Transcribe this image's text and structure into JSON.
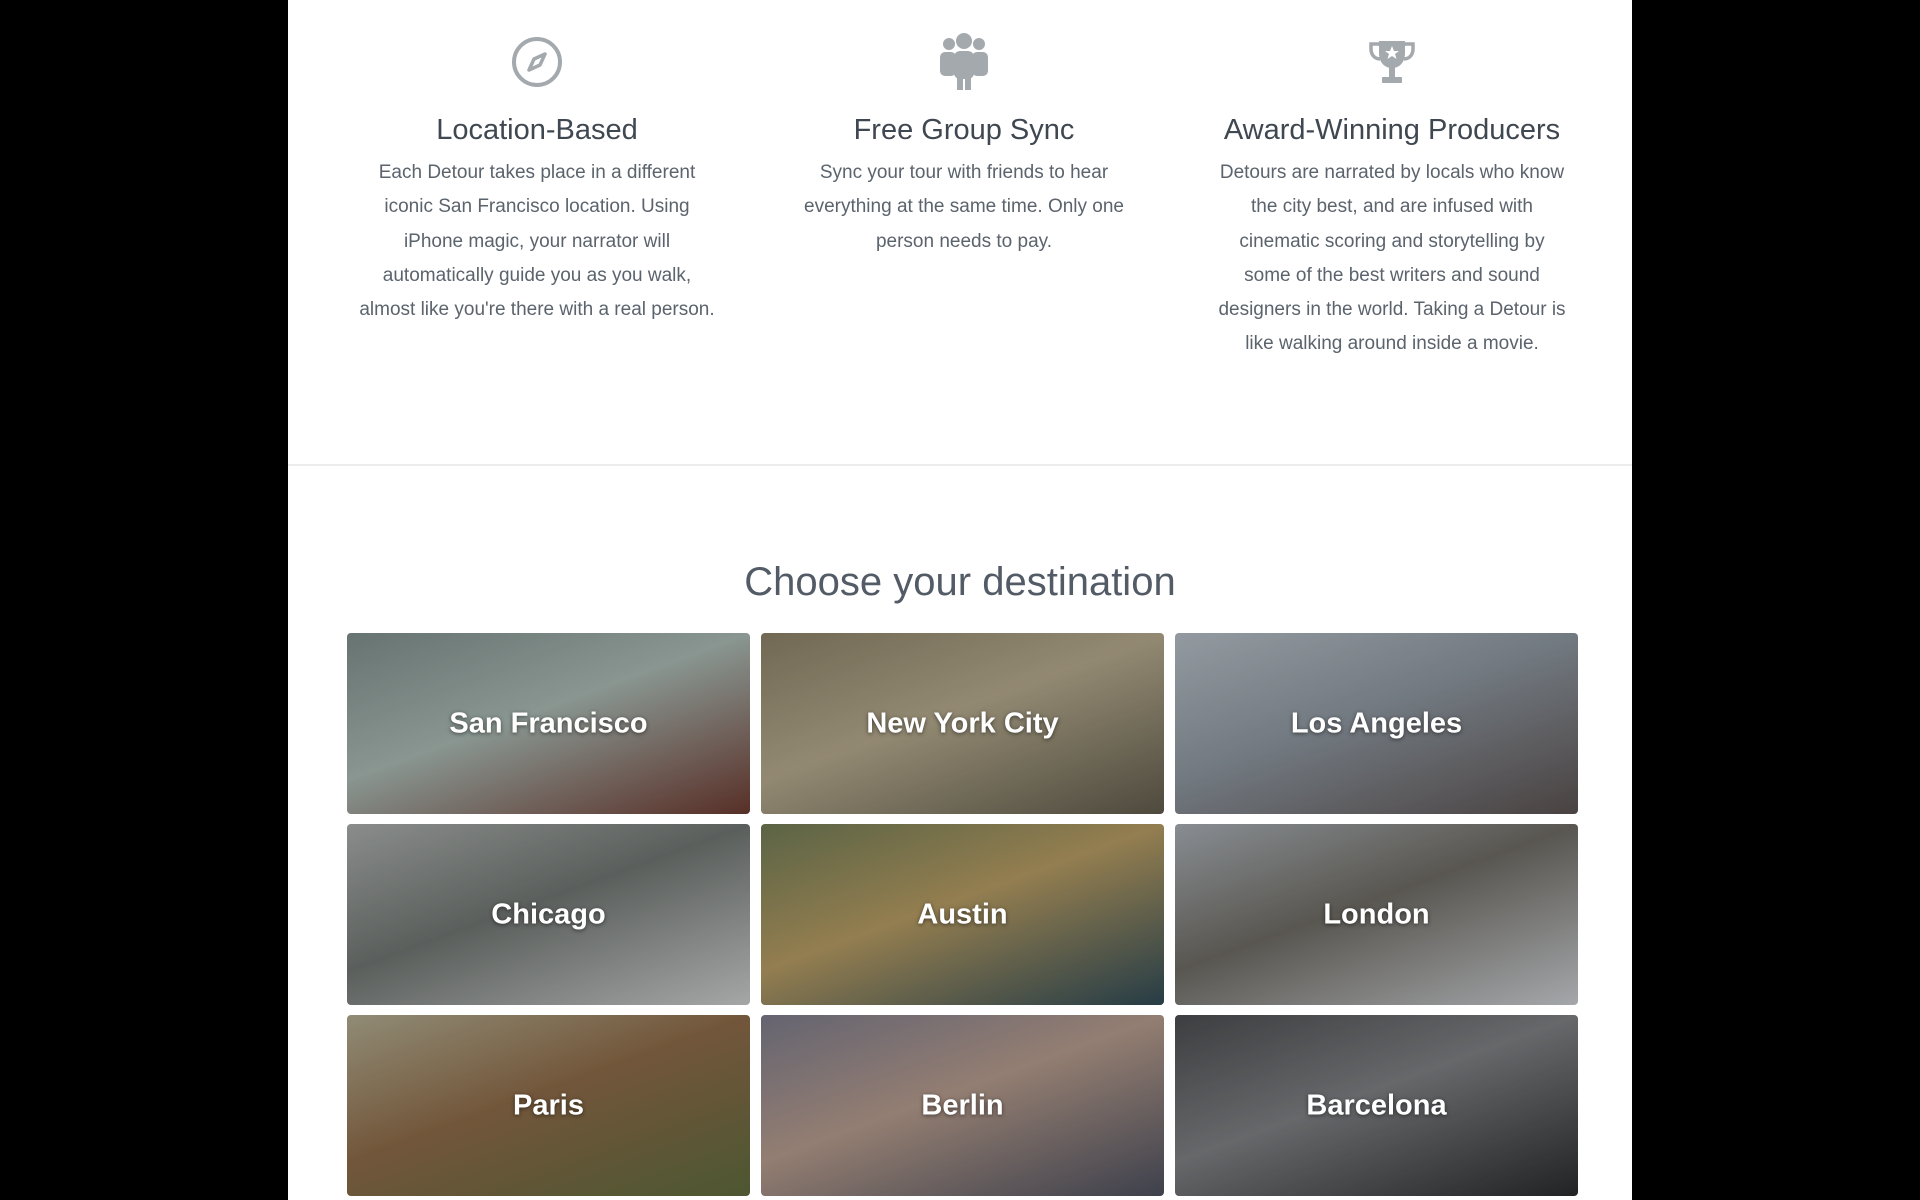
{
  "features": [
    {
      "icon": "compass-icon",
      "title": "Location-Based",
      "lines": [
        "Each Detour takes place in a different",
        "iconic San Francisco location. Using",
        "iPhone magic, your narrator will",
        "automatically guide you as you walk,",
        "almost like you're there with a real person."
      ]
    },
    {
      "icon": "group-icon",
      "title": "Free Group Sync",
      "lines": [
        "Sync your tour with friends to hear",
        "everything at the same time. Only one",
        "person needs to pay."
      ]
    },
    {
      "icon": "trophy-icon",
      "title": "Award-Winning Producers",
      "lines": [
        "Detours are narrated by locals who know",
        "the city best, and are infused with",
        "cinematic scoring and storytelling by",
        "some of the best writers and sound",
        "designers in the world. Taking a Detour is",
        "like walking around inside a movie."
      ]
    }
  ],
  "destinations": {
    "title": "Choose your destination",
    "cities": [
      {
        "name": "San Francisco",
        "colors": [
          "#7d8d8a",
          "#a8b7b1",
          "#6b3a30"
        ]
      },
      {
        "name": "New York City",
        "colors": [
          "#8a8066",
          "#b3a88c",
          "#5f5a4b"
        ]
      },
      {
        "name": "Los Angeles",
        "colors": [
          "#b4bcc4",
          "#8c959e",
          "#5a5150"
        ]
      },
      {
        "name": "Chicago",
        "colors": [
          "#a8acaa",
          "#6f7471",
          "#c9cccb"
        ]
      },
      {
        "name": "Austin",
        "colors": [
          "#6f7a55",
          "#b49a62",
          "#2f4a55"
        ]
      },
      {
        "name": "London",
        "colors": [
          "#a7adb3",
          "#6d6a63",
          "#c9ccd0"
        ]
      },
      {
        "name": "Paris",
        "colors": [
          "#b1ab90",
          "#8c6a48",
          "#5e6b3d"
        ]
      },
      {
        "name": "Berlin",
        "colors": [
          "#7b7a8a",
          "#b49a8b",
          "#4c4f5d"
        ]
      },
      {
        "name": "Barcelona",
        "colors": [
          "#4a4c4f",
          "#7d7f82",
          "#2a2b2d"
        ]
      }
    ]
  }
}
